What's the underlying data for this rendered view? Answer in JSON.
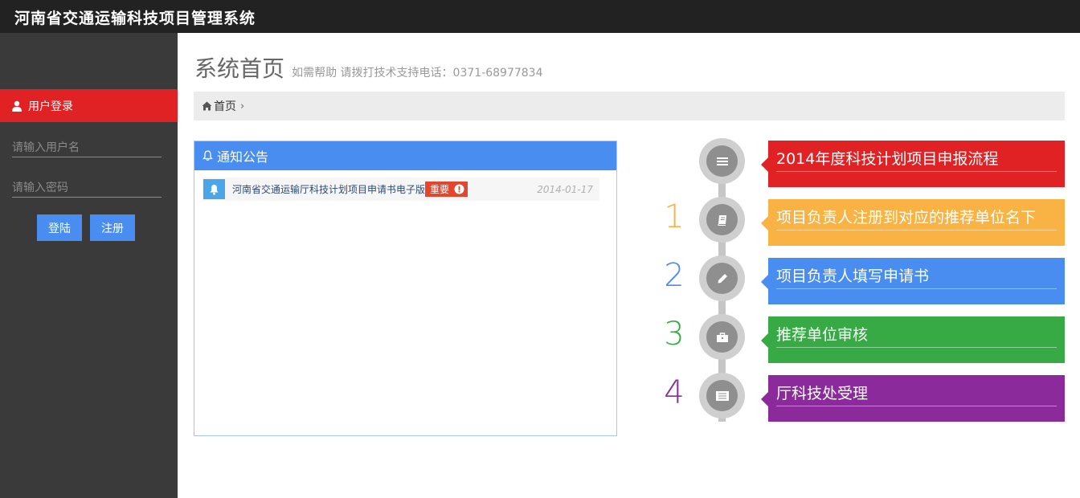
{
  "app": {
    "title": "河南省交通运输科技项目管理系统"
  },
  "sidebar": {
    "login_header": "用户登录",
    "username_placeholder": "请输入用户名",
    "password_placeholder": "请输入密码",
    "login_button": "登陆",
    "register_button": "注册"
  },
  "main": {
    "title": "系统首页",
    "subtitle": "如需帮助 请拨打技术支持电话：0371-68977834",
    "breadcrumb": {
      "home": "首页",
      "separator": "›"
    }
  },
  "notice": {
    "header": "通知公告",
    "items": [
      {
        "title": "河南省交通运输厅科技计划项目申请书电子版",
        "badge": "重要",
        "date": "2014-01-17"
      }
    ]
  },
  "timeline": {
    "colors": {
      "header": "#e02224",
      "step1": "#f9b244",
      "step2": "#4a8df0",
      "step3": "#37aa46",
      "step4": "#8a2a9b"
    },
    "header": {
      "label": "2014年度科技计划项目申报流程",
      "icon": "list-icon"
    },
    "steps": [
      {
        "num": "1",
        "label": "项目负责人注册到对应的推荐单位名下",
        "icon": "book-icon"
      },
      {
        "num": "2",
        "label": "项目负责人填写申请书",
        "icon": "pencil-icon"
      },
      {
        "num": "3",
        "label": "推荐单位审核",
        "icon": "briefcase-icon"
      },
      {
        "num": "4",
        "label": "厅科技处受理",
        "icon": "document-list-icon"
      }
    ]
  }
}
